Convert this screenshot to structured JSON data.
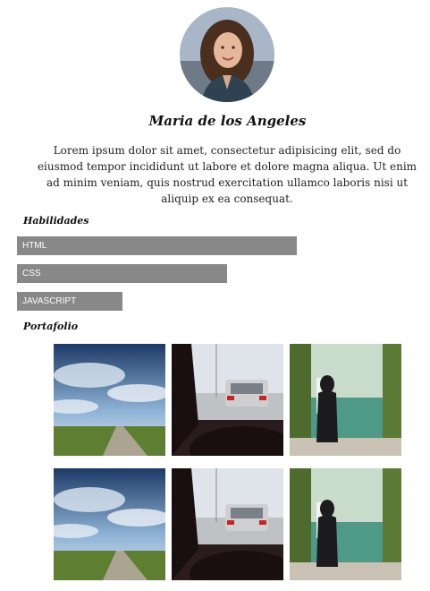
{
  "profile": {
    "name": "Maria de los Angeles",
    "bio": "Lorem ipsum dolor sit amet, consectetur adipisicing elit, sed do eiusmod tempor incididunt ut labore et dolore magna aliqua. Ut enim ad minim veniam, quis nostrud exercitation ullamco laboris nisi ut aliquip ex ea consequat."
  },
  "skills": {
    "title": "Habilidades",
    "items": [
      {
        "label": "HTML",
        "level": 0.8
      },
      {
        "label": "CSS",
        "level": 0.6
      },
      {
        "label": "JAVASCRIPT",
        "level": 0.3
      }
    ]
  },
  "portfolio": {
    "title": "Portafolio",
    "items": [
      {
        "kind": "sky-landscape-photo"
      },
      {
        "kind": "car-road-photo"
      },
      {
        "kind": "lake-person-photo"
      },
      {
        "kind": "sky-landscape-photo"
      },
      {
        "kind": "car-road-photo"
      },
      {
        "kind": "lake-person-photo"
      }
    ]
  },
  "colors": {
    "bar": "#888888",
    "bar_text": "#ffffff"
  }
}
